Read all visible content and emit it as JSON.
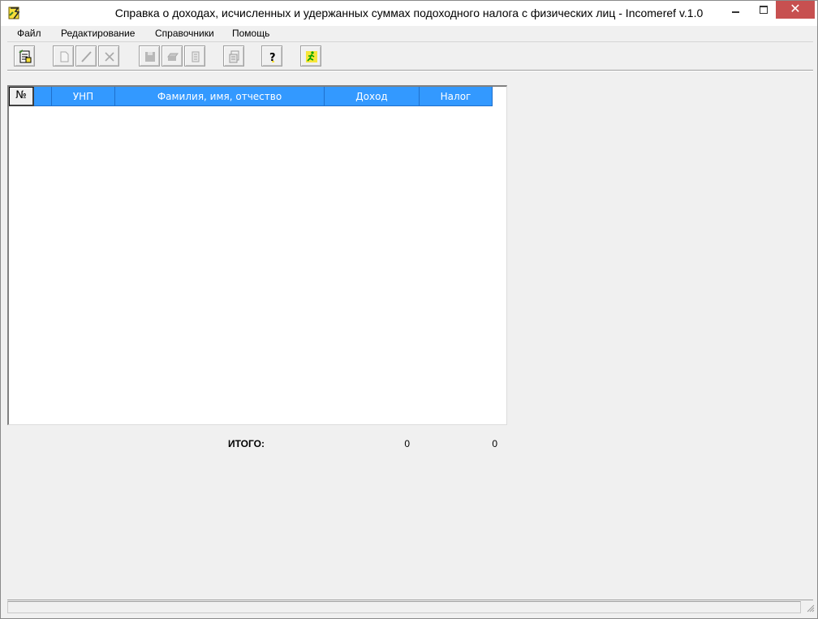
{
  "window": {
    "title": "Справка о доходах, исчисленных и удержанных суммах подоходного налога с физических лиц - Incomeref v.1.0",
    "controls": {
      "minimize": "minimize-icon",
      "maximize": "maximize-icon",
      "close": "✕"
    }
  },
  "menu": {
    "items": [
      {
        "label": "Файл"
      },
      {
        "label": "Редактирование"
      },
      {
        "label": "Справочники"
      },
      {
        "label": "Помощь"
      }
    ]
  },
  "toolbar": {
    "buttons": [
      {
        "icon": "open-document-icon",
        "enabled": true
      },
      {
        "icon": "new-document-icon",
        "enabled": false
      },
      {
        "icon": "edit-pencil-icon",
        "enabled": false
      },
      {
        "icon": "delete-x-icon",
        "enabled": false
      },
      {
        "icon": "save-disk-icon",
        "enabled": false
      },
      {
        "icon": "print-icon",
        "enabled": false
      },
      {
        "icon": "page-icon",
        "enabled": false
      },
      {
        "icon": "report-icon",
        "enabled": false
      },
      {
        "icon": "help-icon",
        "enabled": true
      },
      {
        "icon": "exit-icon",
        "enabled": true
      }
    ]
  },
  "grid": {
    "columns": [
      {
        "label": "№"
      },
      {
        "label": ""
      },
      {
        "label": "УНП"
      },
      {
        "label": "Фамилия, имя, отчество"
      },
      {
        "label": "Доход"
      },
      {
        "label": "Налог"
      }
    ],
    "rows": []
  },
  "totals": {
    "label": "ИТОГО:",
    "income": "0",
    "tax": "0"
  },
  "colors": {
    "header_bg": "#3399ff",
    "window_bg": "#f0f0f0",
    "close_button": "#c75050"
  }
}
